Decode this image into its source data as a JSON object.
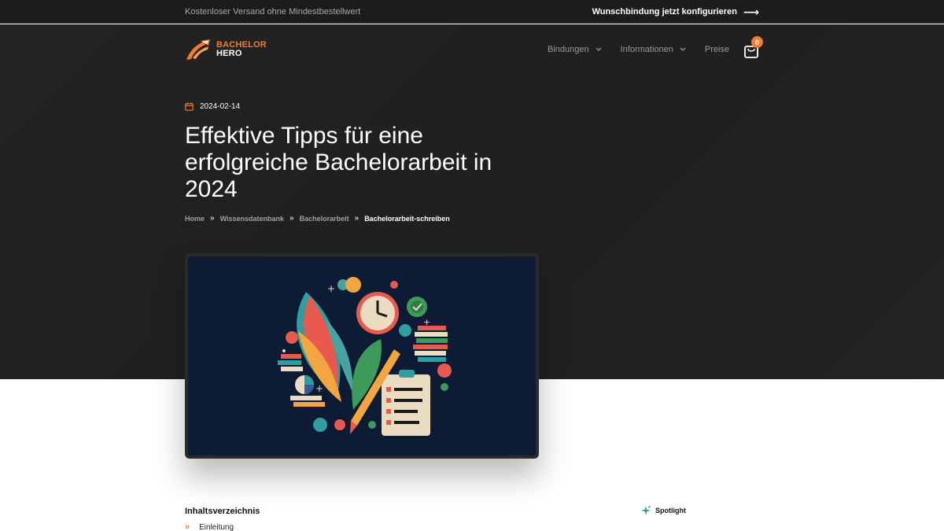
{
  "topbar": {
    "promo": "Kostenloser Versand ohne Mindestbestellwert",
    "cta_label": "Wunschbindung jetzt konfigurieren"
  },
  "header": {
    "logo_line1": "BACHELOR",
    "logo_line2": "HERO",
    "nav": [
      {
        "label": "Bindungen"
      },
      {
        "label": "Informationen"
      },
      {
        "label": "Preise"
      }
    ],
    "cart_count": "0"
  },
  "article": {
    "date": "2024-02-14",
    "title": "Effektive Tipps für eine erfolgreiche Bachelorarbeit in 2024",
    "breadcrumb": [
      "Home",
      "Wissensdatenbank",
      "Bachelorarbeit",
      "Bachelorarbeit-schreiben"
    ]
  },
  "toc": {
    "title": "Inhaltsverzeichnis",
    "items": [
      "Einleitung"
    ]
  },
  "sidebar": {
    "spotlight_label": "Spotlight"
  },
  "colors": {
    "accent": "#ef7d34",
    "hero_bg": "#202020",
    "topbar_bg": "#1c1c1c",
    "image_bg": "#0d1b34",
    "spotlight_icon": "#2a9d8f"
  },
  "icons": {
    "date": "calendar-icon",
    "cta": "arrow-right-icon",
    "cart": "shopping-bag-icon",
    "toc": "double-chevron-icon",
    "spotlight": "sparkle-icon"
  }
}
